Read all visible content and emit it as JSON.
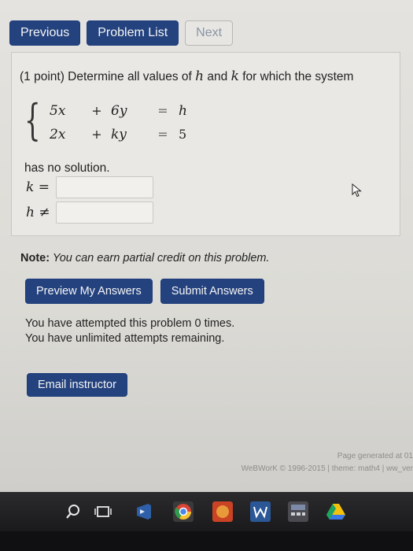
{
  "nav": {
    "previous": "Previous",
    "problem_list": "Problem List",
    "next": "Next"
  },
  "problem": {
    "intro_prefix": "(1 point) Determine all values of ",
    "var_h": "h",
    "intro_and": " and ",
    "var_k": "k",
    "intro_suffix": " for which the system",
    "system": {
      "row1": {
        "c1": "5x",
        "op": "+",
        "c2": "6y",
        "eq": "=",
        "rhs": "h"
      },
      "row2": {
        "c1": "2x",
        "op": "+",
        "c2": "ky",
        "eq": "=",
        "rhs": "5"
      }
    },
    "no_solution": "has no solution.",
    "answers": [
      {
        "label": "k =",
        "value": ""
      },
      {
        "label": "h ≠",
        "value": ""
      }
    ]
  },
  "note": {
    "label": "Note:",
    "text": " You can earn partial credit on this problem."
  },
  "actions": {
    "preview": "Preview My Answers",
    "submit": "Submit Answers"
  },
  "attempts": {
    "line1": "You have attempted this problem 0 times.",
    "line2": "You have unlimited attempts remaining."
  },
  "email_label": "Email instructor",
  "footer": {
    "generated": "Page generated at 01",
    "copyright": "WeBWorK © 1996-2015 | theme: math4 | ww_ver"
  },
  "taskbar_icons": [
    "search-icon",
    "task-view-icon",
    "visual-studio-icon",
    "chrome-icon",
    "app-icon",
    "word-icon",
    "calculator-icon",
    "drive-icon"
  ]
}
